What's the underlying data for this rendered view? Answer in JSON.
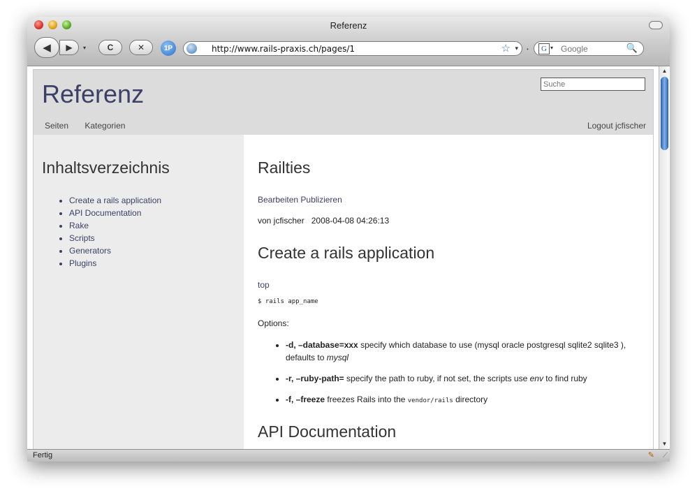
{
  "window": {
    "title": "Referenz"
  },
  "toolbar": {
    "back_icon": "◀",
    "forward_icon": "▶",
    "dropdown_icon": "▾",
    "reload_icon": "C",
    "stop_icon": "✕",
    "onepassword_label": "1P",
    "url": "http://www.rails-praxis.ch/pages/1",
    "bookmark_icon": "☆",
    "url_caret": "▾",
    "search_engine_icon": "G",
    "search_placeholder": "Google",
    "magnifier_icon": "🔍"
  },
  "site": {
    "title": "Referenz",
    "search_placeholder": "Suche",
    "nav": [
      "Seiten",
      "Kategorien"
    ],
    "logout": "Logout jcfischer"
  },
  "sidebar": {
    "heading": "Inhaltsverzeichnis",
    "toc": [
      "Create a rails application",
      "API Documentation",
      "Rake",
      "Scripts",
      "Generators",
      "Plugins"
    ]
  },
  "main": {
    "title": "Railties",
    "edit_link": "Bearbeiten",
    "publish_link": "Publizieren",
    "byline_author": "von jcfischer",
    "byline_date": "2008-04-08 04:26:13",
    "section1_title": "Create a rails application",
    "top_link": "top",
    "code": "$ rails app_name",
    "options_label": "Options:",
    "options": [
      {
        "flag": "-d, –database=xxx",
        "text": " specify which database to use (mysql oracle postgresql sqlite2 sqlite3 ), defaults to ",
        "em": "mysql",
        "tail": ""
      },
      {
        "flag": "-r, –ruby-path=",
        "text": " specify the path to ruby, if not set, the scripts use ",
        "em": "env",
        "tail": " to find ruby"
      },
      {
        "flag": "-f, –freeze",
        "text": " freezes Rails into the ",
        "code": "vendor/rails",
        "tail": " directory"
      }
    ],
    "section2_title": "API Documentation"
  },
  "status": {
    "text": "Fertig"
  }
}
